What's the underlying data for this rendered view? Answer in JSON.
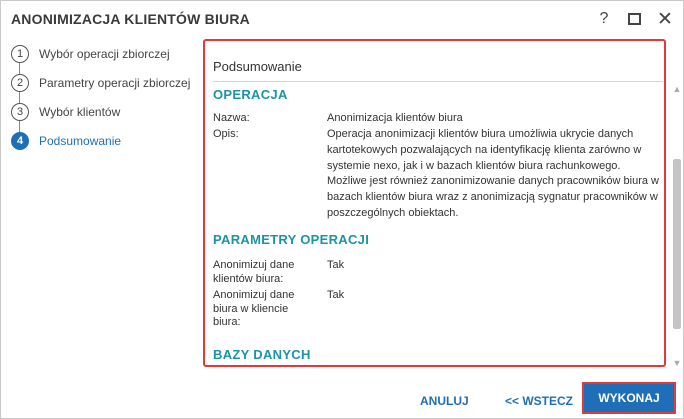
{
  "window": {
    "title": "ANONIMIZACJA KLIENTÓW BIURA",
    "help_symbol": "?",
    "close_symbol": "✕"
  },
  "steps": [
    {
      "number": "1",
      "label": "Wybór operacji zbiorczej",
      "active": false
    },
    {
      "number": "2",
      "label": "Parametry operacji zbiorczej",
      "active": false
    },
    {
      "number": "3",
      "label": "Wybór klientów",
      "active": false
    },
    {
      "number": "4",
      "label": "Podsumowanie",
      "active": true
    }
  ],
  "summary": {
    "title": "Podsumowanie",
    "operation": {
      "heading": "OPERACJA",
      "name_label": "Nazwa:",
      "name_value": "Anonimizacja klientów biura",
      "desc_label": "Opis:",
      "desc_lines": [
        "Operacja anonimizacji klientów biura umożliwia ukrycie danych",
        "kartotekowych pozwalających na identyfikację klienta zarówno w",
        "systemie nexo, jak i w bazach klientów biura rachunkowego.",
        "Możliwe jest również zanonimizowanie danych pracowników biura w",
        "bazach klientów biura wraz z anonimizacją sygnatur pracowników w",
        "poszczególnych obiektach."
      ]
    },
    "parameters": {
      "heading": "PARAMETRY OPERACJI",
      "rows": [
        {
          "label_lines": [
            "Anonimizuj dane",
            "klientów biura:"
          ],
          "value": "Tak"
        },
        {
          "label_lines": [
            "Anonimizuj dane",
            "biura w kliencie",
            "biura:"
          ],
          "value": "Tak"
        }
      ]
    },
    "databases": {
      "heading": "BAZY DANYCH"
    }
  },
  "scrollbar": {
    "up_symbol": "▲",
    "down_symbol": "▼"
  },
  "footer": {
    "cancel_label": "ANULUJ",
    "back_label": "<< WSTECZ",
    "run_label": "WYKONAJ"
  },
  "colors": {
    "accent": "#1e6fb8",
    "section_heading": "#1b94a6",
    "highlight_border": "#e03b3b"
  }
}
